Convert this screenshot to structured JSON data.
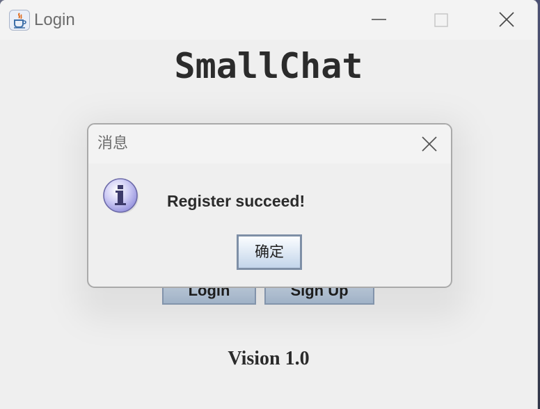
{
  "window": {
    "title": "Login",
    "controls": [
      "minimize-icon",
      "maximize-icon",
      "close-icon"
    ]
  },
  "main": {
    "heading": "SmallChat",
    "login_label": "Login",
    "signup_label": "Sign Up",
    "version": "Vision 1.0"
  },
  "dialog": {
    "title": "消息",
    "message": "Register succeed!",
    "ok_label": "确定",
    "icon": "info-icon"
  },
  "colors": {
    "window_bg": "#efefef",
    "titlebar_bg": "#f3f3f3",
    "button_gradient_top": "#fbfdff",
    "button_gradient_bottom": "#c3d5ea",
    "info_icon_fill": "#c9c6f3"
  }
}
